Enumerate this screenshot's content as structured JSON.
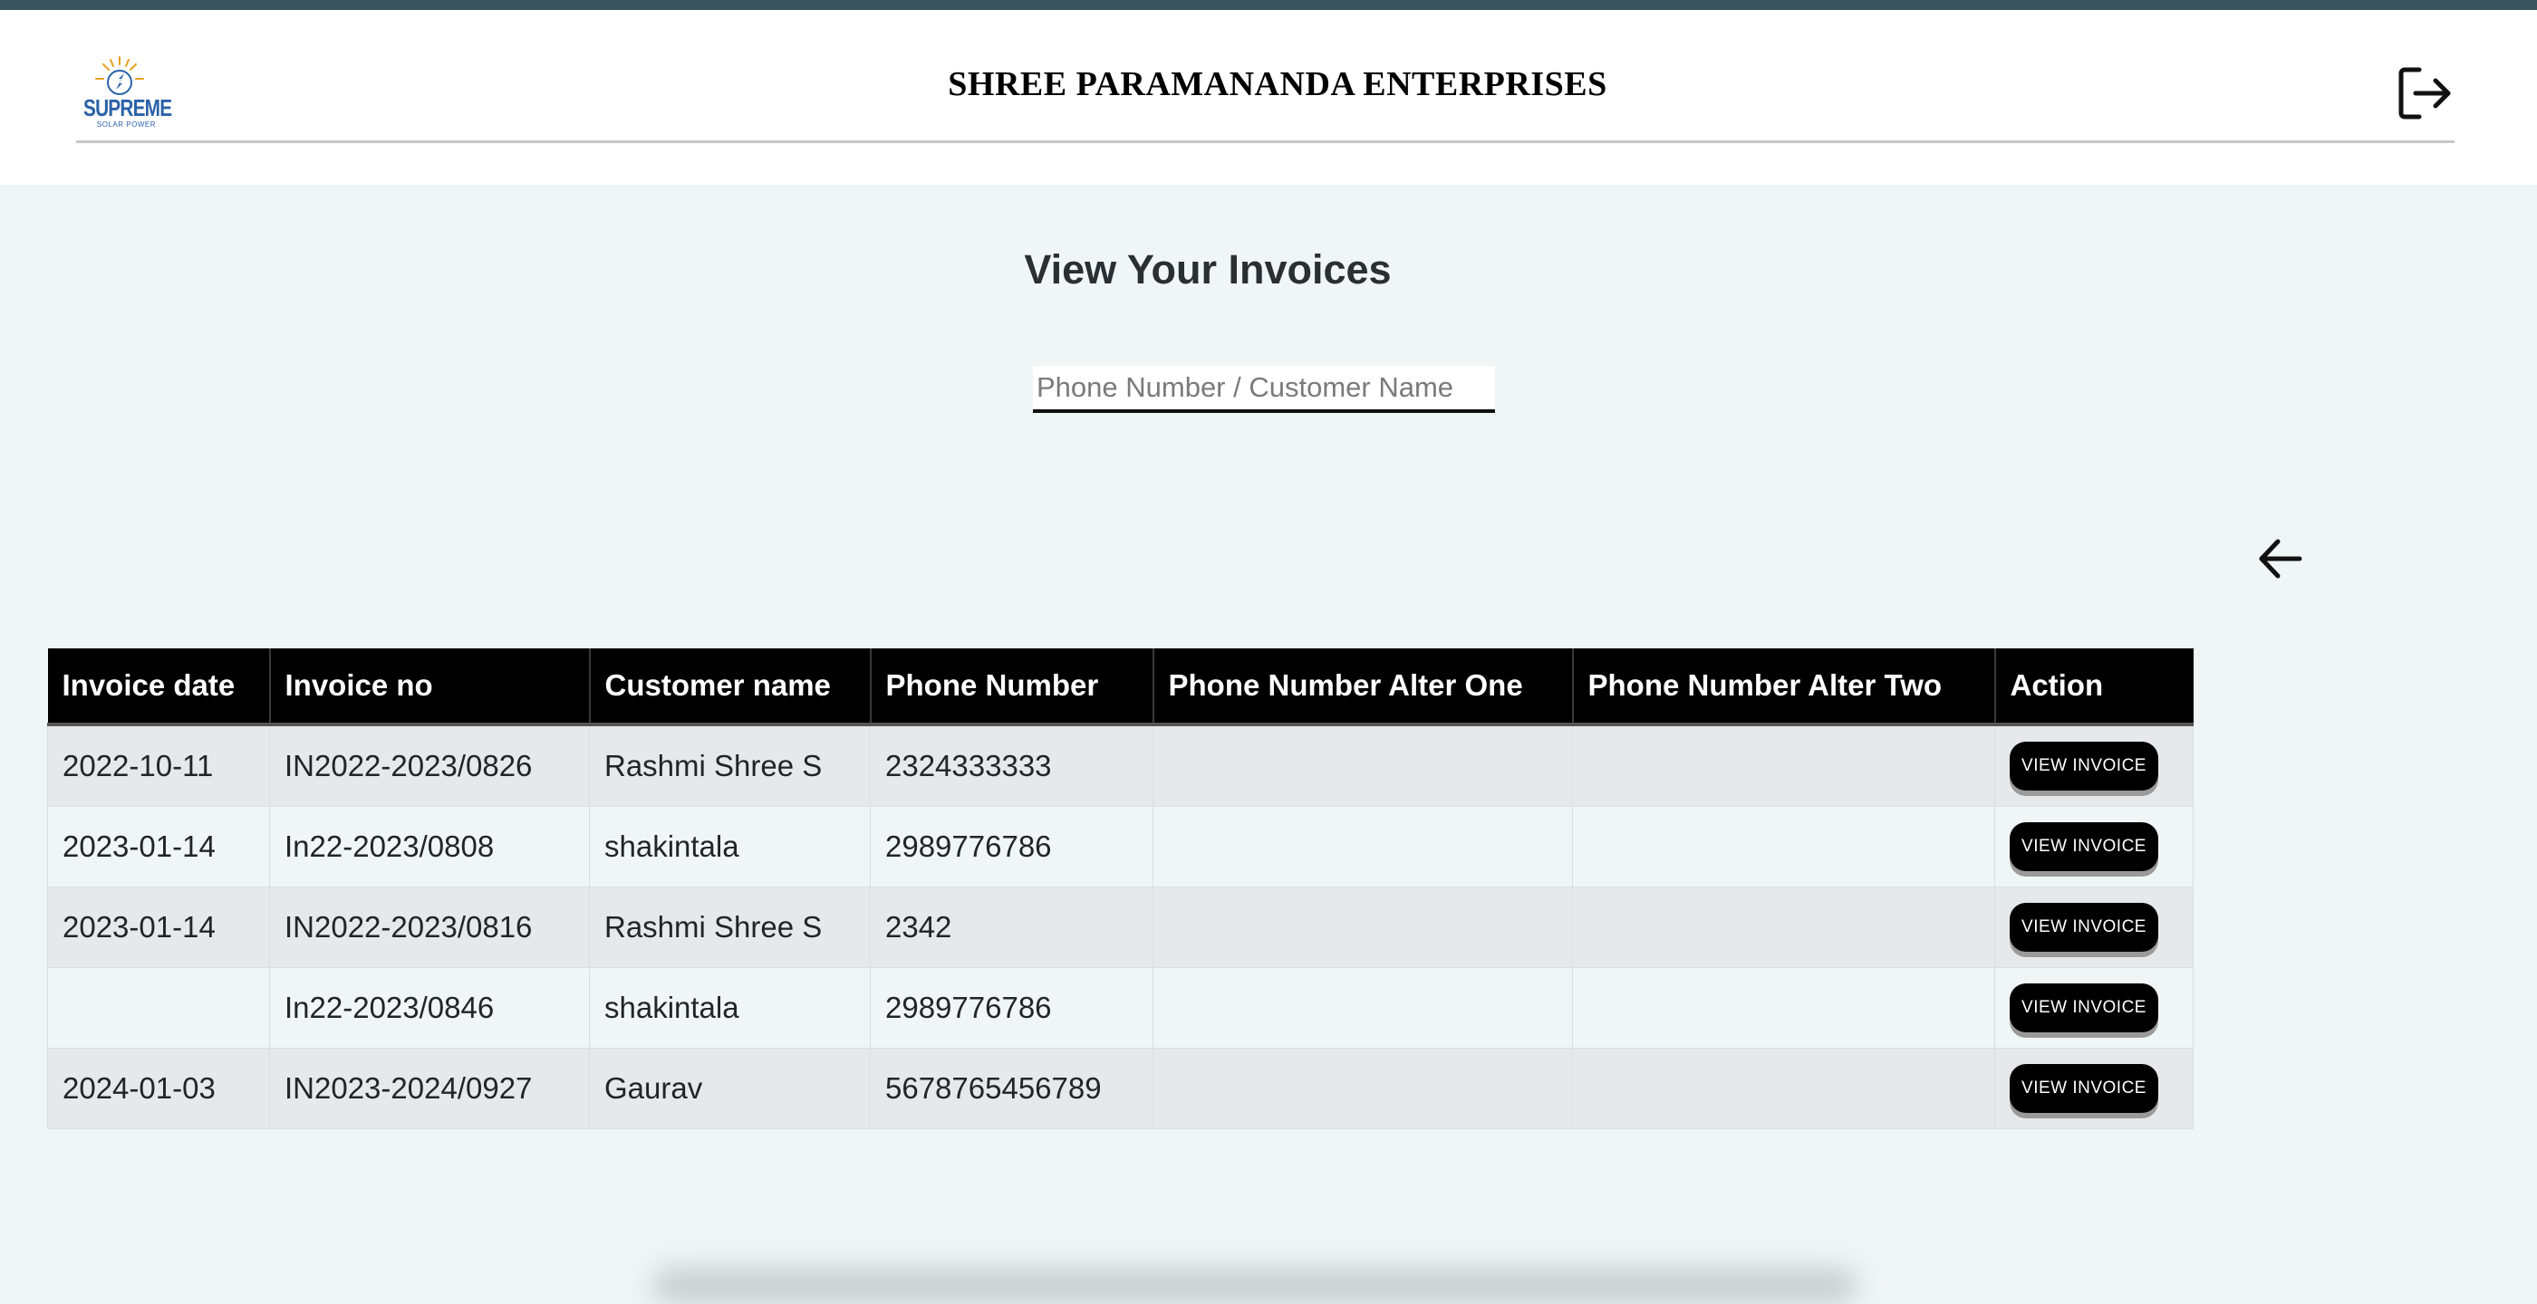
{
  "header": {
    "logo_text": "SUPREME",
    "logo_subtext": "SOLAR POWER",
    "company_name": "SHREE PARAMANANDA ENTERPRISES",
    "logout_icon": "logout-icon"
  },
  "main": {
    "title": "View Your Invoices",
    "search": {
      "placeholder": "Phone Number / Customer Name",
      "value": ""
    },
    "back_icon": "arrow-left-icon"
  },
  "table": {
    "columns": [
      "Invoice date",
      "Invoice no",
      "Customer name",
      "Phone Number",
      "Phone Number Alter One",
      "Phone Number Alter Two",
      "Action"
    ],
    "rows": [
      {
        "date": "2022-10-11",
        "invoice_no": "IN2022-2023/0826",
        "customer": "Rashmi Shree S",
        "phone": "2324333333",
        "alt_one": "",
        "alt_two": "",
        "action": "VIEW INVOICE"
      },
      {
        "date": "2023-01-14",
        "invoice_no": "In22-2023/0808",
        "customer": "shakintala",
        "phone": "2989776786",
        "alt_one": "",
        "alt_two": "",
        "action": "VIEW INVOICE"
      },
      {
        "date": "2023-01-14",
        "invoice_no": "IN2022-2023/0816",
        "customer": "Rashmi Shree S",
        "phone": "2342",
        "alt_one": "",
        "alt_two": "",
        "action": "VIEW INVOICE"
      },
      {
        "date": "",
        "invoice_no": "In22-2023/0846",
        "customer": "shakintala",
        "phone": "2989776786",
        "alt_one": "",
        "alt_two": "",
        "action": "VIEW INVOICE"
      },
      {
        "date": "2024-01-03",
        "invoice_no": "IN2023-2024/0927",
        "customer": "Gaurav",
        "phone": "5678765456789",
        "alt_one": "",
        "alt_two": "",
        "action": "VIEW INVOICE"
      }
    ]
  },
  "colors": {
    "top_strip": "#3a5560",
    "page_background": "#f0f5f5",
    "table_header": "#000000",
    "button": "#000000"
  }
}
